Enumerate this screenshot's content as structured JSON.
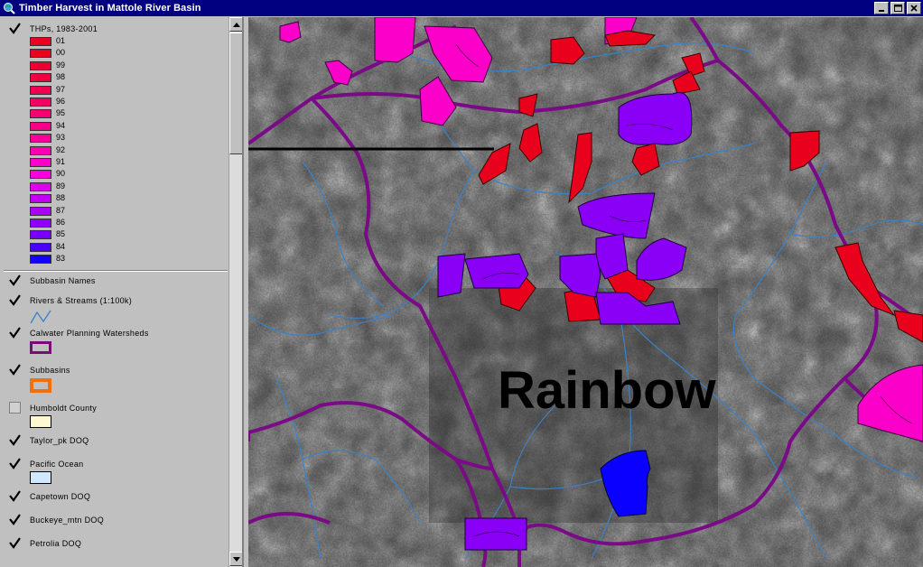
{
  "window": {
    "title": "Timber Harvest in Mattole River Basin",
    "buttons": [
      "minimize",
      "maximize",
      "close"
    ]
  },
  "toc": {
    "thp_layer": {
      "label": "THPs, 1983-2001",
      "checked": true,
      "legend": [
        {
          "year": "01",
          "color": "#e8001c"
        },
        {
          "year": "00",
          "color": "#e8001e"
        },
        {
          "year": "99",
          "color": "#ec0030"
        },
        {
          "year": "98",
          "color": "#ee0040"
        },
        {
          "year": "97",
          "color": "#f00050"
        },
        {
          "year": "96",
          "color": "#f20062"
        },
        {
          "year": "95",
          "color": "#f40074"
        },
        {
          "year": "94",
          "color": "#f60088"
        },
        {
          "year": "93",
          "color": "#f8009c"
        },
        {
          "year": "92",
          "color": "#fa00b0"
        },
        {
          "year": "91",
          "color": "#fa00c8"
        },
        {
          "year": "90",
          "color": "#f800de"
        },
        {
          "year": "89",
          "color": "#e000f0"
        },
        {
          "year": "88",
          "color": "#c400f4"
        },
        {
          "year": "87",
          "color": "#aa00f6"
        },
        {
          "year": "86",
          "color": "#9000f8"
        },
        {
          "year": "85",
          "color": "#7600fa"
        },
        {
          "year": "84",
          "color": "#4a00fc"
        },
        {
          "year": "83",
          "color": "#1400ff"
        }
      ]
    },
    "layers": [
      {
        "label": "Subbasin Names",
        "checked": true
      },
      {
        "label": "Rivers & Streams (1:100k)",
        "checked": true
      },
      {
        "label": "Calwater Planning Watersheds",
        "checked": true
      },
      {
        "label": "Subbasins",
        "checked": true
      },
      {
        "label": "Humboldt County",
        "checked": false
      },
      {
        "label": "Taylor_pk DOQ",
        "checked": true
      },
      {
        "label": "Pacific Ocean",
        "checked": true
      },
      {
        "label": "Capetown DOQ",
        "checked": true
      },
      {
        "label": "Buckeye_mtn DOQ",
        "checked": true
      },
      {
        "label": "Petrolia DOQ",
        "checked": true
      }
    ],
    "colors": {
      "river": "#3a7fd0",
      "watershed": "#7a0a7a",
      "subbasin": "#f07010",
      "county": "#fff8d0",
      "ocean": "#d0e8ff"
    }
  },
  "map": {
    "label": "Rainbow",
    "colors": {
      "boundary": "#7a0a86",
      "stream": "#3a82c8",
      "thp_recent": "#e8001c",
      "thp_mid": "#fa00c8",
      "thp_old": "#8a00f6",
      "thp_oldest": "#0a00ff"
    }
  }
}
